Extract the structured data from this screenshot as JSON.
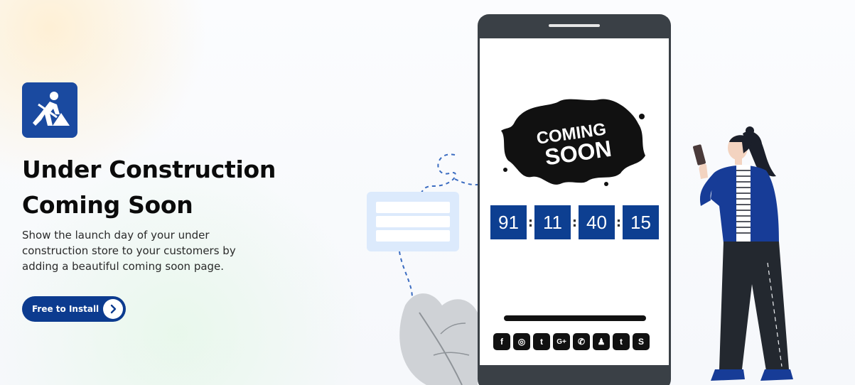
{
  "hero": {
    "logo_icon": "construction-worker-icon",
    "title_line1": "Under Construction",
    "title_line2": "Coming Soon",
    "description": "Show the launch day of your under construction store to your customers by adding a beautiful coming soon page.",
    "install_button": "Free to Install",
    "install_icon": "chevron-right-icon"
  },
  "phone": {
    "coming_soon_line1": "COMING",
    "coming_soon_line2": "SOON",
    "countdown": [
      "91",
      "11",
      "40",
      "15"
    ],
    "separator": ":",
    "social_icons": [
      {
        "name": "facebook-icon",
        "glyph": "f"
      },
      {
        "name": "instagram-icon",
        "glyph": "◎"
      },
      {
        "name": "twitter-icon",
        "glyph": "t"
      },
      {
        "name": "google-plus-icon",
        "glyph": "G+"
      },
      {
        "name": "whatsapp-icon",
        "glyph": "✆"
      },
      {
        "name": "snapchat-icon",
        "glyph": "♟"
      },
      {
        "name": "tumblr-icon",
        "glyph": "t"
      },
      {
        "name": "skype-icon",
        "glyph": "S"
      }
    ]
  },
  "colors": {
    "brand_blue": "#0c3b8f",
    "countdown_bg": "#0d3f91",
    "phone_frame": "#3a4046"
  }
}
